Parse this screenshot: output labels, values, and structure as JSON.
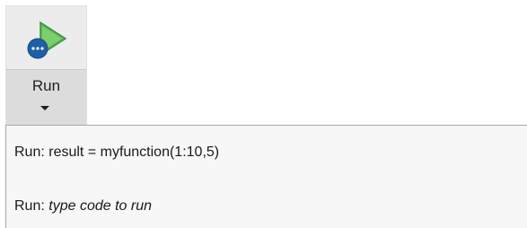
{
  "run_button": {
    "label": "Run",
    "icon": "run-play-icon",
    "icon_colors": {
      "play": "#4caf50",
      "badge": "#1f5fa8",
      "dots": "#ffffff"
    }
  },
  "dropdown": {
    "items": [
      {
        "prefix": "Run: ",
        "code": "result = myfunction(1:10,5)"
      },
      {
        "prefix": "Run: ",
        "placeholder": "type code to run"
      }
    ]
  }
}
